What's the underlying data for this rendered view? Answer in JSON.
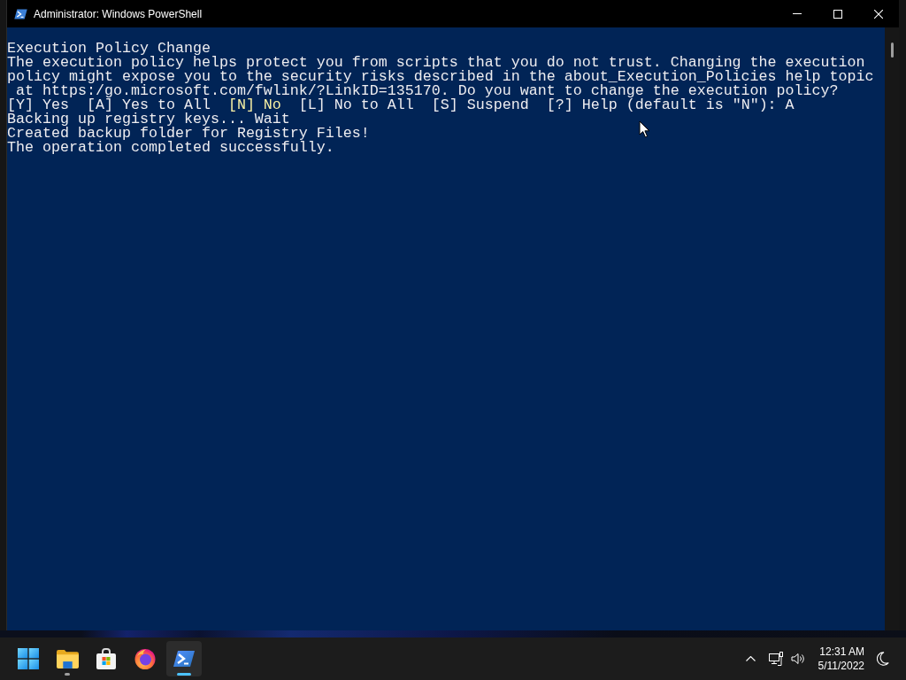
{
  "window": {
    "title": "Administrator: Windows PowerShell"
  },
  "console": {
    "lines": [
      {
        "segments": [
          {
            "text": "Execution Policy Change",
            "highlighted": false
          }
        ]
      },
      {
        "segments": [
          {
            "text": "The execution policy helps protect you from scripts that you do not trust. Changing the execution",
            "highlighted": false
          }
        ]
      },
      {
        "segments": [
          {
            "text": "policy might expose you to the security risks described in the about_Execution_Policies help topic",
            "highlighted": false
          }
        ]
      },
      {
        "segments": [
          {
            "text": " at https:/go.microsoft.com/fwlink/?LinkID=135170. Do you want to change the execution policy?",
            "highlighted": false
          }
        ]
      },
      {
        "segments": [
          {
            "text": "[Y] Yes  [A] Yes to All  ",
            "highlighted": false
          },
          {
            "text": "[N] No",
            "highlighted": true
          },
          {
            "text": "  [L] No to All  [S] Suspend  [?] Help (default is \"N\"): A",
            "highlighted": false
          }
        ]
      },
      {
        "segments": [
          {
            "text": "Backing up registry keys... Wait",
            "highlighted": false
          }
        ]
      },
      {
        "segments": [
          {
            "text": "Created backup folder for Registry Files!",
            "highlighted": false
          }
        ]
      },
      {
        "segments": [
          {
            "text": "The operation completed successfully.",
            "highlighted": false
          }
        ]
      }
    ]
  },
  "taskbar": {
    "apps": [
      {
        "kind": "start",
        "running": false,
        "selected": false
      },
      {
        "kind": "folder",
        "running": true,
        "selected": false
      },
      {
        "kind": "store",
        "running": false,
        "selected": false
      },
      {
        "kind": "browser",
        "running": false,
        "selected": false
      },
      {
        "kind": "terminal",
        "running": true,
        "selected": true
      }
    ]
  },
  "tray": {
    "time": "12:31 AM",
    "date": "5/11/2022"
  }
}
